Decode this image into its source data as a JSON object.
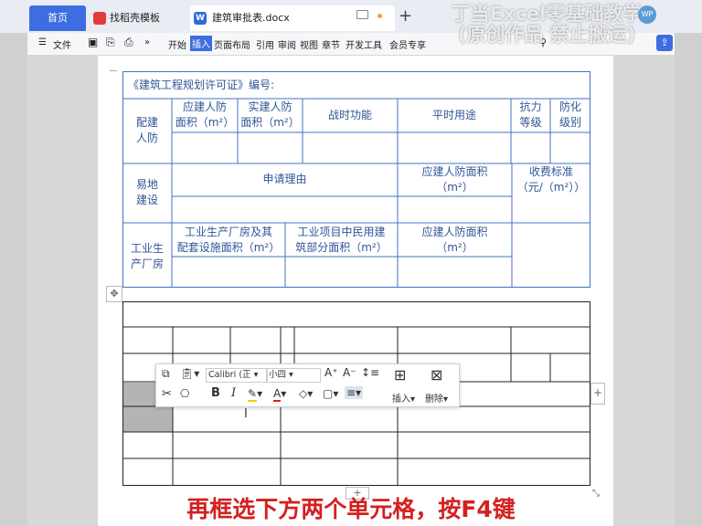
{
  "tabs": {
    "home": "首页",
    "template": "找稻壳模板",
    "doc": "建筑审批表.docx",
    "new": "+"
  },
  "watermark": {
    "line1": "丁当Excel零基础教学",
    "line2": "(原创作品 禁止搬运)"
  },
  "avatar": "WP",
  "ribbon": {
    "file": "文件",
    "items": [
      "开始",
      "插入",
      "页面布局",
      "引用",
      "审阅",
      "视图",
      "章节",
      "开发工具",
      "会员专享"
    ],
    "active": "插入",
    "expand": "»"
  },
  "form": {
    "title": "《建筑工程规划许可证》编号:",
    "r1_label": "配建\n人防",
    "h_should_area": "应建人防\n面积（m²）",
    "h_actual_area": "实建人防\n面积（m²）",
    "h_war": "战时功能",
    "h_peace": "平时用途",
    "h_resist": "抗力\n等级",
    "h_chem": "防化\n级别",
    "r2_label": "易地\n建设",
    "h_reason": "申请理由",
    "h_should_area2": "应建人防面积\n（m²）",
    "h_fee": "收费标准\n（元/（m²））",
    "r3_label": "工业生\n产厂房",
    "h_factory": "工业生产厂房及其\n配套设施面积（m²）",
    "h_civil": "工业项目中民用建\n筑部分面积（m²）",
    "h_should_area3": "应建人防面积\n（m²）"
  },
  "toolbar": {
    "font": "Calibri (正",
    "size": "小四",
    "bold": "B",
    "italic": "I",
    "insert": "插入",
    "delete": "删除"
  },
  "table_controls": {
    "move": "✥",
    "add_col": "+",
    "add_row": "+",
    "resize": "⤡"
  },
  "caption": "再框选下方两个单元格，按F4键",
  "colors": {
    "accent": "#3d6de0",
    "form_text": "#2f5597",
    "form_border": "#4472c4",
    "caption": "#d42020"
  }
}
